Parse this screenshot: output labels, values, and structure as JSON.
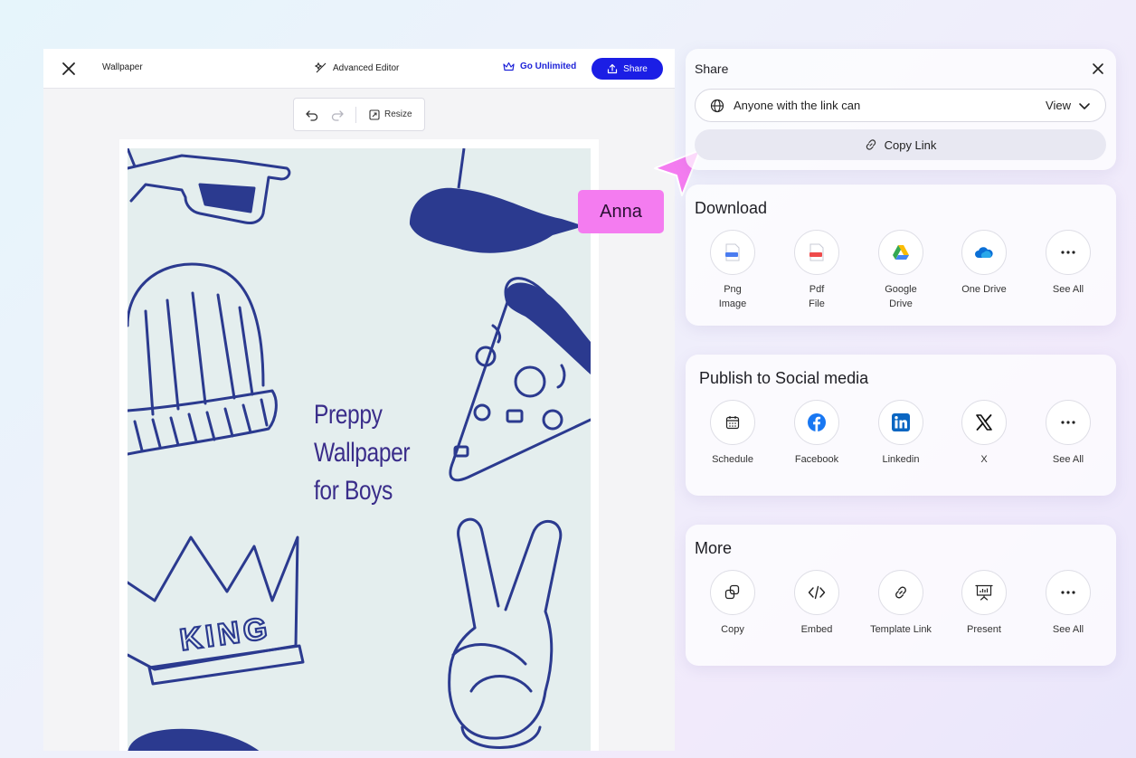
{
  "editor": {
    "document_title": "Wallpaper",
    "advanced_editor_label": "Advanced Editor",
    "go_unlimited_label": "Go Unlimited",
    "share_label": "Share",
    "resize_label": "Resize",
    "poster": {
      "title_lines": [
        "Preppy",
        "Wallpaper",
        "for Boys"
      ],
      "crown_text": "KING"
    }
  },
  "collaborator": {
    "name": "Anna",
    "color": "#f47cf0"
  },
  "share_panel": {
    "title": "Share",
    "permission_label": "Anyone with the link can",
    "permission_value": "View",
    "copy_link_label": "Copy Link"
  },
  "download": {
    "title": "Download",
    "items": [
      {
        "label": "Png\nImage",
        "icon": "png-file-icon"
      },
      {
        "label": "Pdf\nFile",
        "icon": "pdf-file-icon"
      },
      {
        "label": "Google\nDrive",
        "icon": "google-drive-icon"
      },
      {
        "label": "One Drive",
        "icon": "onedrive-icon"
      },
      {
        "label": "See All",
        "icon": "more-icon"
      }
    ]
  },
  "social": {
    "title": "Publish to Social media",
    "items": [
      {
        "label": "Schedule",
        "icon": "calendar-icon"
      },
      {
        "label": "Facebook",
        "icon": "facebook-icon"
      },
      {
        "label": "Linkedin",
        "icon": "linkedin-icon"
      },
      {
        "label": "X",
        "icon": "x-icon"
      },
      {
        "label": "See All",
        "icon": "more-icon"
      }
    ]
  },
  "more": {
    "title": "More",
    "items": [
      {
        "label": "Copy",
        "icon": "copy-icon"
      },
      {
        "label": "Embed",
        "icon": "code-icon"
      },
      {
        "label": "Template Link",
        "icon": "link-icon"
      },
      {
        "label": "Present",
        "icon": "presentation-icon"
      },
      {
        "label": "See All",
        "icon": "more-icon"
      }
    ]
  },
  "colors": {
    "accent": "#1b1ee5",
    "poster_ink": "#2b3a8f",
    "poster_bg": "#e4eeee",
    "title_purple": "#3a2d8a"
  }
}
